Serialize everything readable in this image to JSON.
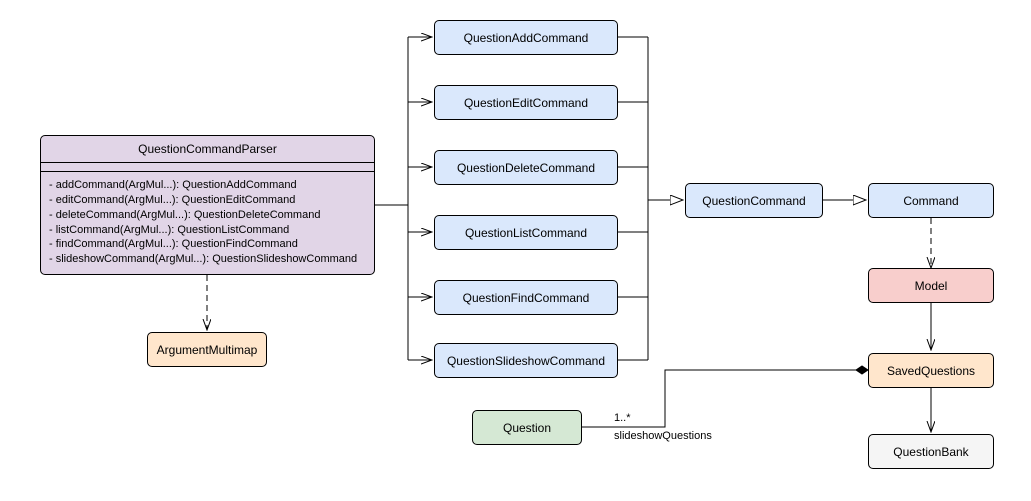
{
  "parser": {
    "title": "QuestionCommandParser",
    "methods": [
      "- addCommand(ArgMul...): QuestionAddCommand",
      "- editCommand(ArgMul...): QuestionEditCommand",
      "- deleteCommand(ArgMul...): QuestionDeleteCommand",
      "- listCommand(ArgMul...): QuestionListCommand",
      "- findCommand(ArgMul...): QuestionFindCommand",
      "- slideshowCommand(ArgMul...): QuestionSlideshowCommand"
    ]
  },
  "nodes": {
    "argmultimap": "ArgumentMultimap",
    "cmd_add": "QuestionAddCommand",
    "cmd_edit": "QuestionEditCommand",
    "cmd_delete": "QuestionDeleteCommand",
    "cmd_list": "QuestionListCommand",
    "cmd_find": "QuestionFindCommand",
    "cmd_slide": "QuestionSlideshowCommand",
    "qcommand": "QuestionCommand",
    "command": "Command",
    "model": "Model",
    "savedq": "SavedQuestions",
    "qbank": "QuestionBank",
    "question": "Question"
  },
  "assoc": {
    "mult": "1..*",
    "role": "slideshowQuestions"
  },
  "colors": {
    "blue": "#dae8fc",
    "purple": "#e1d5e7",
    "yellow": "#ffe6cc",
    "red": "#f8cecc",
    "green": "#d5e8d4",
    "grey": "#f5f5f5"
  }
}
